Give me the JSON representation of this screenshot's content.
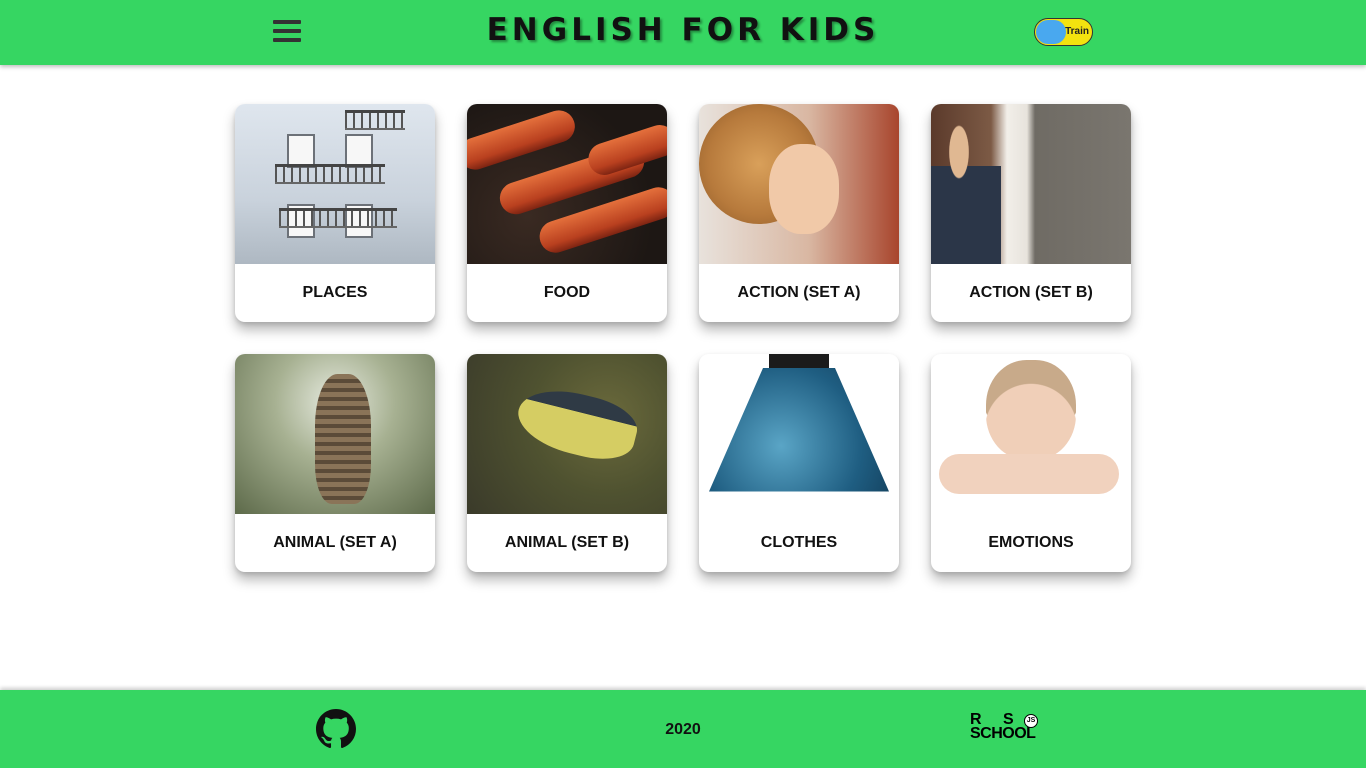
{
  "header": {
    "title": "ENGLISH FOR KIDS",
    "mode_toggle_label": "Train"
  },
  "categories": [
    {
      "label": "PLACES",
      "image": "apartment building with balconies"
    },
    {
      "label": "FOOD",
      "image": "grilled sausages"
    },
    {
      "label": "ACTION (SET A)",
      "image": "child covering face"
    },
    {
      "label": "ACTION (SET B)",
      "image": "boy opening door"
    },
    {
      "label": "ANIMAL (SET A)",
      "image": "tabby cat sitting"
    },
    {
      "label": "ANIMAL (SET B)",
      "image": "great tit bird"
    },
    {
      "label": "CLOTHES",
      "image": "blue skirt"
    },
    {
      "label": "EMOTIONS",
      "image": "sad boy"
    }
  ],
  "footer": {
    "year": "2020",
    "github_icon": "github-icon",
    "school_logo_line1": "R S",
    "school_logo_line2": "SCHOOL",
    "school_logo_badge": "JS"
  },
  "colors": {
    "accent": "#36d662",
    "toggle_bg": "#f3e20f",
    "toggle_knob": "#49a8ef"
  }
}
